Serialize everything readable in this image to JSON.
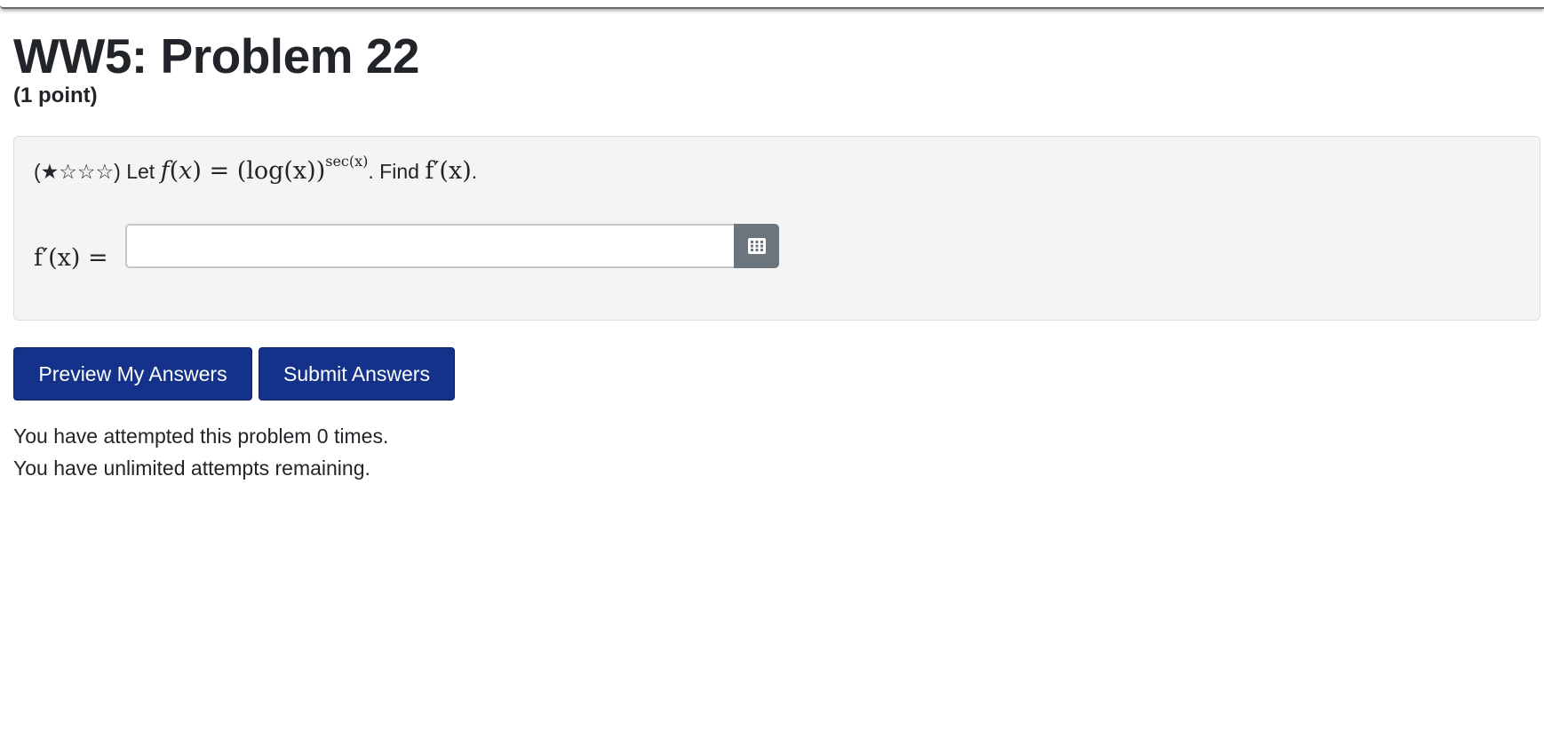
{
  "problem": {
    "title": "WW5: Problem 22",
    "points": "(1 point)",
    "difficulty_stars": "(★☆☆☆)",
    "statement_prefix": "Let",
    "function_name": "f",
    "variable": "x",
    "equals": "=",
    "base_expression": "(log(x))",
    "exponent": "sec(x)",
    "statement_mid": ". Find",
    "derivative_expression": "f′(x)",
    "statement_end": "."
  },
  "answer": {
    "label": "f′(x) =",
    "value": "",
    "placeholder": "",
    "equation_editor_icon": "grid-icon"
  },
  "buttons": {
    "preview_label": "Preview My Answers",
    "submit_label": "Submit Answers"
  },
  "status": {
    "attempts_line": "You have attempted this problem 0 times.",
    "remaining_line": "You have unlimited attempts remaining."
  },
  "colors": {
    "primary_button": "#143289",
    "problem_background": "#f4f4f4",
    "equation_button": "#6c757d",
    "text": "#212529"
  }
}
